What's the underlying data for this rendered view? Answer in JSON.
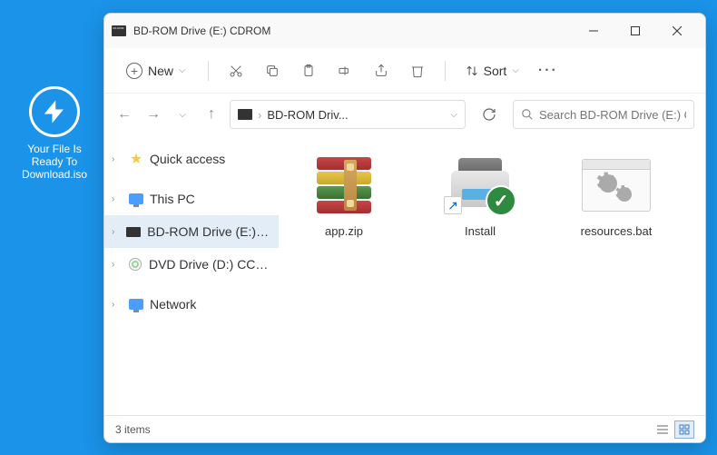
{
  "desktop": {
    "iso_label": "Your File Is Ready To Download.iso"
  },
  "window": {
    "title": "BD-ROM Drive (E:) CDROM",
    "toolbar": {
      "new_label": "New",
      "sort_label": "Sort"
    },
    "address": {
      "path": "BD-ROM Driv..."
    },
    "search": {
      "placeholder": "Search BD-ROM Drive (E:) CD..."
    },
    "nav": {
      "quick_access": "Quick access",
      "this_pc": "This PC",
      "bdrom": "BD-ROM Drive (E:) CDROM",
      "dvd": "DVD Drive (D:) CCCCC",
      "network": "Network"
    },
    "files": {
      "app_zip": "app.zip",
      "install": "Install",
      "resources_bat": "resources.bat"
    },
    "status": {
      "count": "3 items"
    }
  }
}
